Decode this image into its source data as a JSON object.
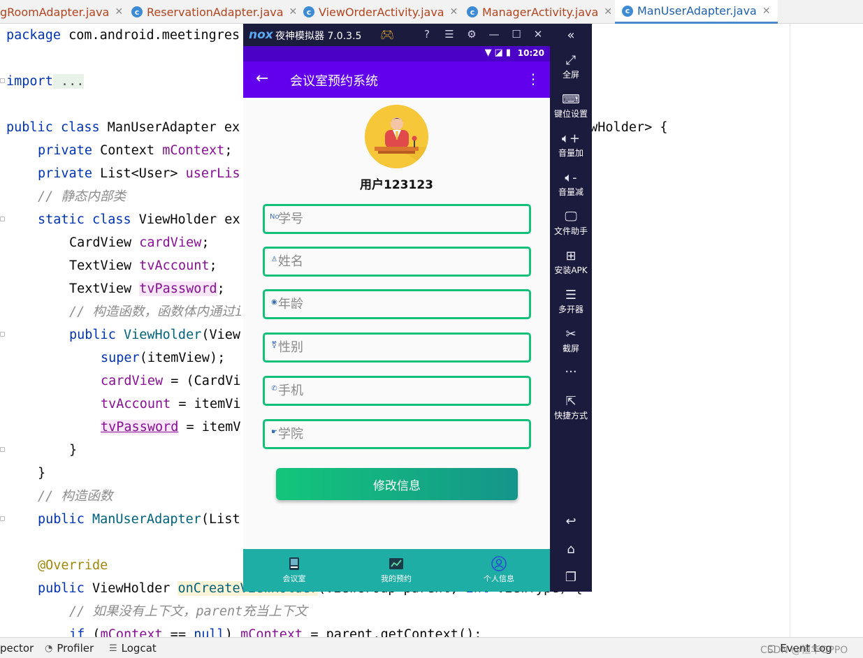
{
  "ide": {
    "tabs": [
      {
        "label": "gRoomAdapter.java",
        "has_icon": false
      },
      {
        "label": "ReservationAdapter.java",
        "has_icon": true
      },
      {
        "label": "ViewOrderActivity.java",
        "has_icon": true
      },
      {
        "label": "ManagerActivity.java",
        "has_icon": true
      },
      {
        "label": "ManUserAdapter.java",
        "has_icon": true,
        "active": true
      }
    ],
    "code": {
      "l1": {
        "kw": "package",
        "rest": " com.android.meetingres"
      },
      "l2": {
        "kw": "import",
        "rest": " ..."
      },
      "l3": {
        "kw": "public class",
        "rest": " ManUserAdapter ex",
        "tail": "ewHolder> {"
      },
      "l4": {
        "kw": "private",
        "type": " Context ",
        "field": "mContext",
        "rest": ";"
      },
      "l5": {
        "kw": "private",
        "type": " List<User> ",
        "field": "userLis"
      },
      "l6": {
        "comment": "// 静态内部类"
      },
      "l7": {
        "kw": "static class",
        "rest": " ViewHolder ex"
      },
      "l8": {
        "type": "CardView ",
        "field": "cardView",
        "rest": ";"
      },
      "l9": {
        "type": "TextView ",
        "field": "tvAccount",
        "rest": ";"
      },
      "l10": {
        "type": "TextView ",
        "field": "tvPassword",
        "rest": ";"
      },
      "l11": {
        "comment": "// 构造函数，函数体内通过it"
      },
      "l12": {
        "kw": "public",
        "method": " ViewHolder",
        "rest": "(View"
      },
      "l13": {
        "kw": "super",
        "rest": "(itemView);"
      },
      "l14": {
        "field": "cardView",
        "rest": " = (CardVi"
      },
      "l15": {
        "field": "tvAccount",
        "rest": " = itemVi"
      },
      "l16": {
        "field": "tvPassword",
        "rest": " = itemV"
      },
      "l17": {
        "rest": "}"
      },
      "l18": {
        "rest": "}"
      },
      "l19": {
        "comment": "// 构造函数"
      },
      "l20": {
        "kw": "public",
        "method": " ManUserAdapter",
        "rest": "(List"
      },
      "l21": {
        "annotation": "@Override"
      },
      "l22": {
        "kw": "public",
        "type": " ViewHolder ",
        "method": "onCreateViewHolder",
        "rest": "(ViewGroup parent, ",
        "kw2": "int",
        "rest2": " viewType) {"
      },
      "l23": {
        "comment": "// 如果没有上下文，parent充当上下文"
      },
      "l24": {
        "kw": "if",
        "rest": " (",
        "field": "mContext",
        "rest2": " == ",
        "kw2": "null",
        "rest3": ") ",
        "field2": "mContext",
        "rest4": " = parent.getContext();"
      }
    },
    "status_bar": {
      "items": [
        "pector",
        "Profiler",
        "Logcat"
      ],
      "right_text": "Event Log",
      "watermark": "CSDN @恒华OPPO"
    }
  },
  "emulator": {
    "logo": "nox",
    "name": "夜神模拟器 7.0.3.5",
    "sidebar": [
      {
        "icon": "fullscreen-icon",
        "label": "全屏"
      },
      {
        "icon": "keyboard-icon",
        "label": "键位设置"
      },
      {
        "icon": "volume-up-icon",
        "label": "音量加"
      },
      {
        "icon": "volume-down-icon",
        "label": "音量减"
      },
      {
        "icon": "file-helper-icon",
        "label": "文件助手"
      },
      {
        "icon": "install-apk-icon",
        "label": "安装APK"
      },
      {
        "icon": "multi-instance-icon",
        "label": "多开器"
      },
      {
        "icon": "scissors-icon",
        "label": "截屏"
      },
      {
        "icon": "more-icon",
        "label": "···"
      },
      {
        "icon": "shortcut-icon",
        "label": "快捷方式"
      }
    ]
  },
  "phone": {
    "status_time": "10:20",
    "app_title": "会议室预约系统",
    "username": "用户123123",
    "fields": [
      {
        "icon": "No",
        "placeholder": "学号",
        "name": "student-id-field"
      },
      {
        "icon": "♙",
        "placeholder": "姓名",
        "name": "name-field"
      },
      {
        "icon": "◉",
        "placeholder": "年龄",
        "name": "age-field"
      },
      {
        "icon": "⚧",
        "placeholder": "性别",
        "name": "gender-field"
      },
      {
        "icon": "✆",
        "placeholder": "手机",
        "name": "phone-field"
      },
      {
        "icon": "☛",
        "placeholder": "学院",
        "name": "college-field"
      }
    ],
    "submit_label": "修改信息",
    "nav": [
      {
        "label": "会议室",
        "icon": "book-icon"
      },
      {
        "label": "我的预约",
        "icon": "chart-icon"
      },
      {
        "label": "个人信息",
        "icon": "person-icon"
      }
    ],
    "colors": {
      "status_bar": "#4b02c6",
      "app_bar": "#6200ee",
      "field_border": "#12c07a",
      "nav_bg": "#1faea6"
    }
  }
}
